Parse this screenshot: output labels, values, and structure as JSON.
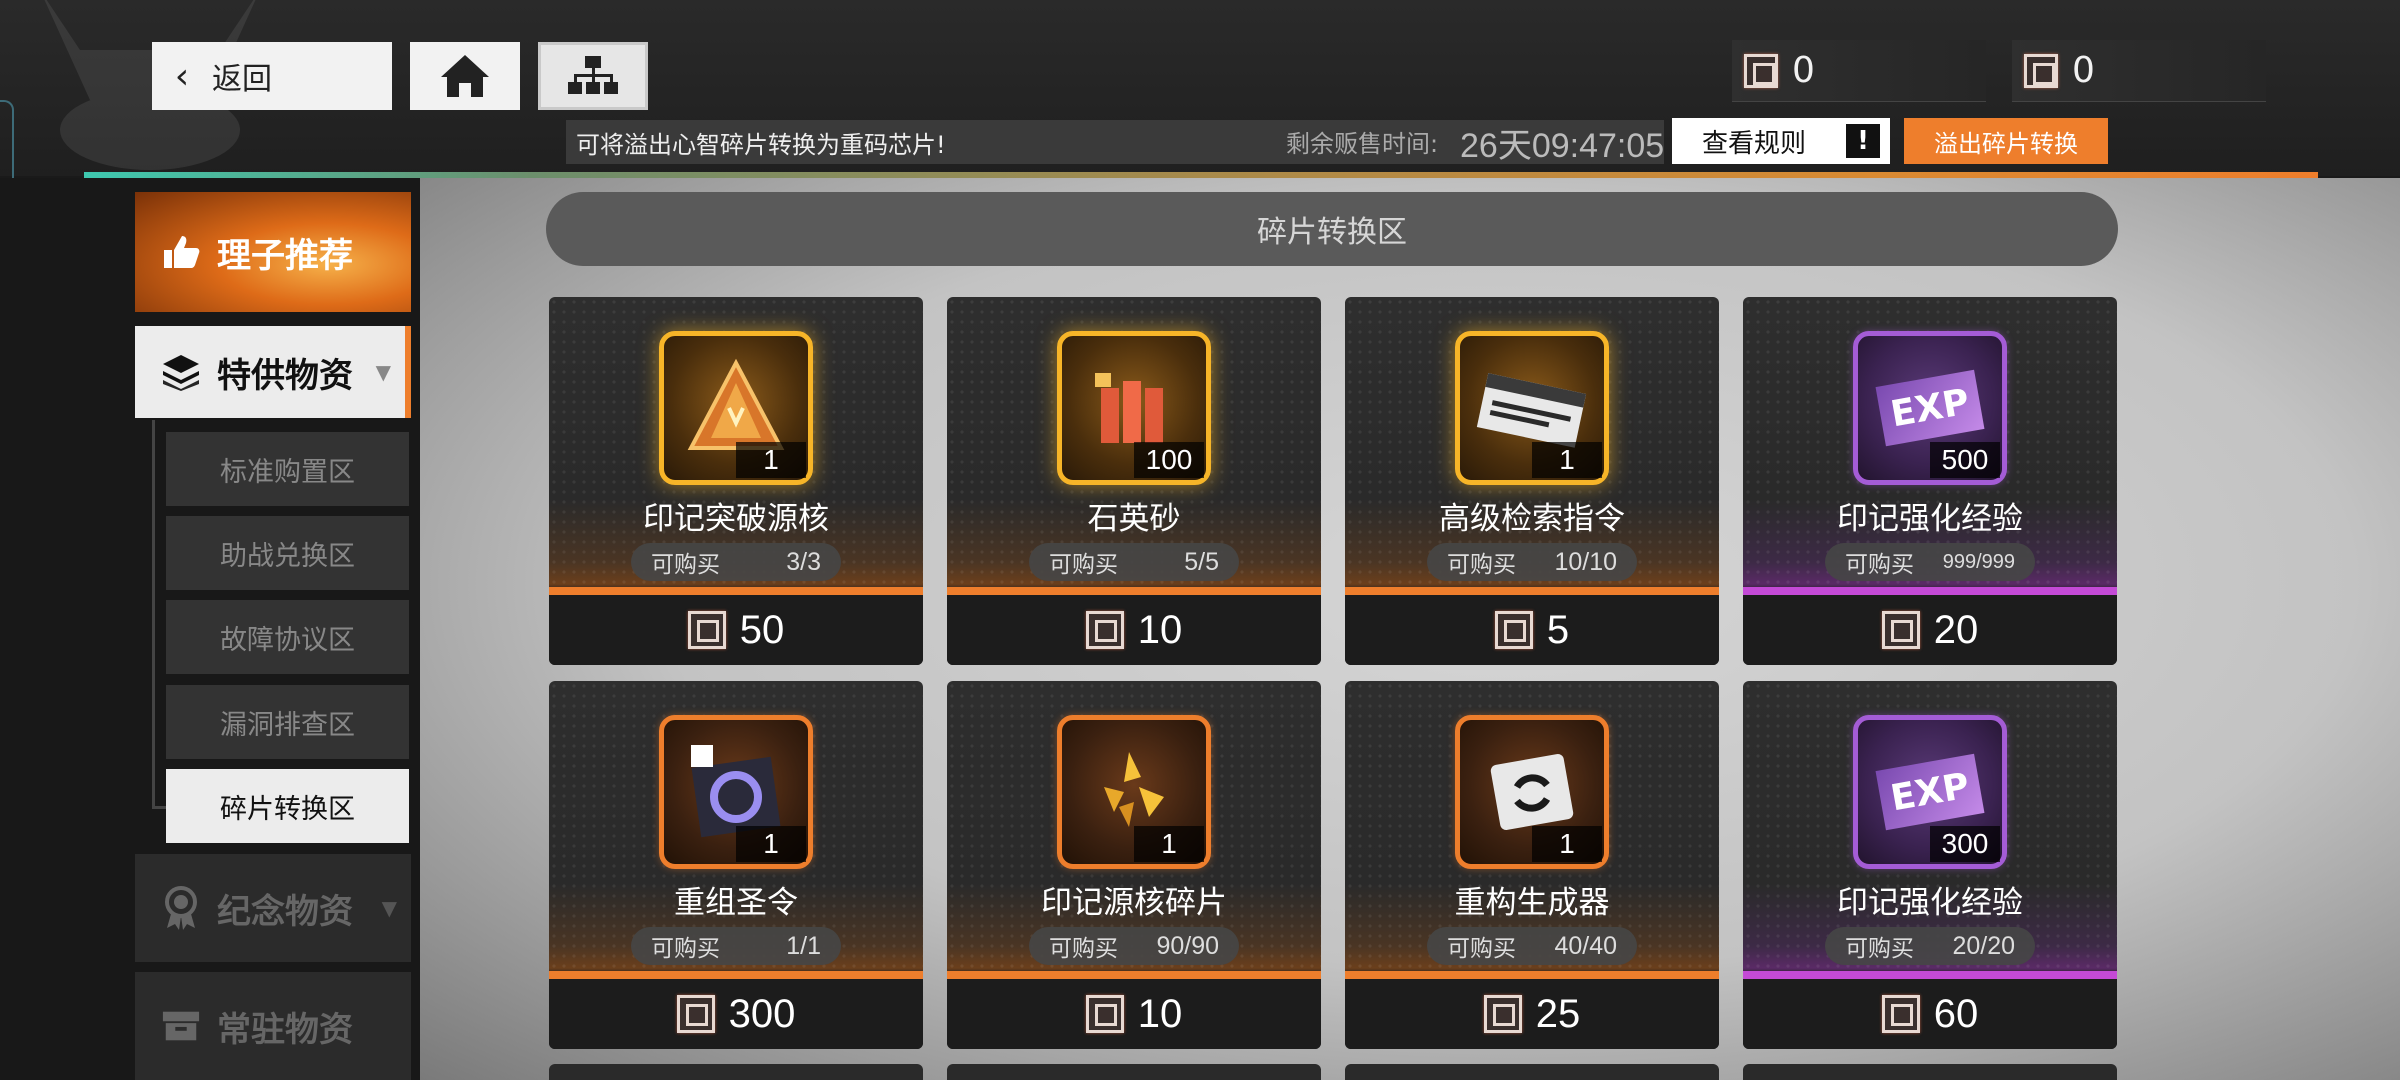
{
  "header": {
    "back_label": "返回",
    "currency": [
      {
        "icon": "chip-icon",
        "value": "0"
      },
      {
        "icon": "chip-icon",
        "value": "0"
      }
    ],
    "notice": "可将溢出心智碎片转换为重码芯片!",
    "timer_label": "剩余贩售时间:",
    "timer_value": "26天09:47:05",
    "rules_label": "查看规则",
    "rules_badge": "!",
    "overflow_label": "溢出碎片转换",
    "colors": {
      "accent": "#ee7e2c",
      "gold": "#f7b528",
      "purple": "#a45cd6"
    }
  },
  "sidebar": {
    "recommend": "理子推荐",
    "special": "特供物资",
    "sub_items": [
      {
        "label": "标准购置区"
      },
      {
        "label": "助战兑换区"
      },
      {
        "label": "故障协议区"
      },
      {
        "label": "漏洞排查区"
      },
      {
        "label": "碎片转换区",
        "active": true
      }
    ],
    "memorial": "纪念物资",
    "regular": "常驻物资"
  },
  "main": {
    "section_title": "碎片转换区",
    "limit_label": "可购买",
    "items": [
      {
        "name": "印记突破源核",
        "qty": "1",
        "limit": "3/3",
        "price": "50",
        "rarity": "gold"
      },
      {
        "name": "石英砂",
        "qty": "100",
        "limit": "5/5",
        "price": "10",
        "rarity": "gold"
      },
      {
        "name": "高级检索指令",
        "qty": "1",
        "limit": "10/10",
        "price": "5",
        "rarity": "gold"
      },
      {
        "name": "印记强化经验",
        "qty": "500",
        "limit": "999/999",
        "price": "20",
        "rarity": "purple",
        "icon_text": "EXP"
      },
      {
        "name": "重组圣令",
        "qty": "1",
        "limit": "1/1",
        "price": "300",
        "rarity": "orange"
      },
      {
        "name": "印记源核碎片",
        "qty": "1",
        "limit": "90/90",
        "price": "10",
        "rarity": "orange"
      },
      {
        "name": "重构生成器",
        "qty": "1",
        "limit": "40/40",
        "price": "25",
        "rarity": "orange"
      },
      {
        "name": "印记强化经验",
        "qty": "300",
        "limit": "20/20",
        "price": "60",
        "rarity": "purple",
        "icon_text": "EXP"
      }
    ]
  }
}
